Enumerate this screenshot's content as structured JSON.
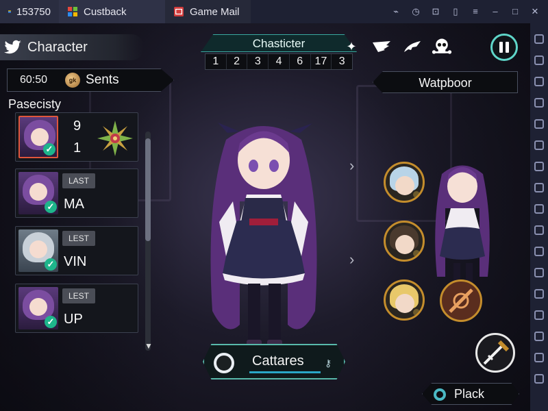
{
  "titlebar": {
    "tabs": [
      {
        "label": "153750",
        "icon": "app-icon"
      },
      {
        "label": "Custback",
        "icon": "windows-icon"
      },
      {
        "label": "Game Mail",
        "icon": "mail-icon"
      }
    ],
    "tools": [
      "brush-icon",
      "clock-icon",
      "gamepad-icon",
      "battery-icon",
      "menu-icon",
      "minimize-icon",
      "maximize-icon",
      "close-icon"
    ]
  },
  "header": {
    "character_label": "Character",
    "center_title": "Chasticter",
    "center_numbers": [
      "1",
      "2",
      "3",
      "4",
      "6",
      "17",
      "3"
    ]
  },
  "left_panel": {
    "timer": "60:50",
    "coin_text": "ǥk",
    "sents_label": "Sents",
    "list_title": "Pasecisty",
    "cards": [
      {
        "top_value": "9",
        "bottom_value": "1",
        "selected": true
      },
      {
        "badge": "LAST",
        "name": "MA"
      },
      {
        "badge": "LEST",
        "name": "VIN"
      },
      {
        "badge": "LΕST",
        "name": "UP"
      }
    ]
  },
  "right_panel": {
    "title": "Watpboor"
  },
  "bottom": {
    "main_button": "Cattares",
    "secondary_button": "Plack"
  },
  "colors": {
    "accent_teal": "#58b9ab",
    "check_green": "#1eb58b",
    "gold_ring": "#c48d2c",
    "selected_border": "#e0563c"
  }
}
